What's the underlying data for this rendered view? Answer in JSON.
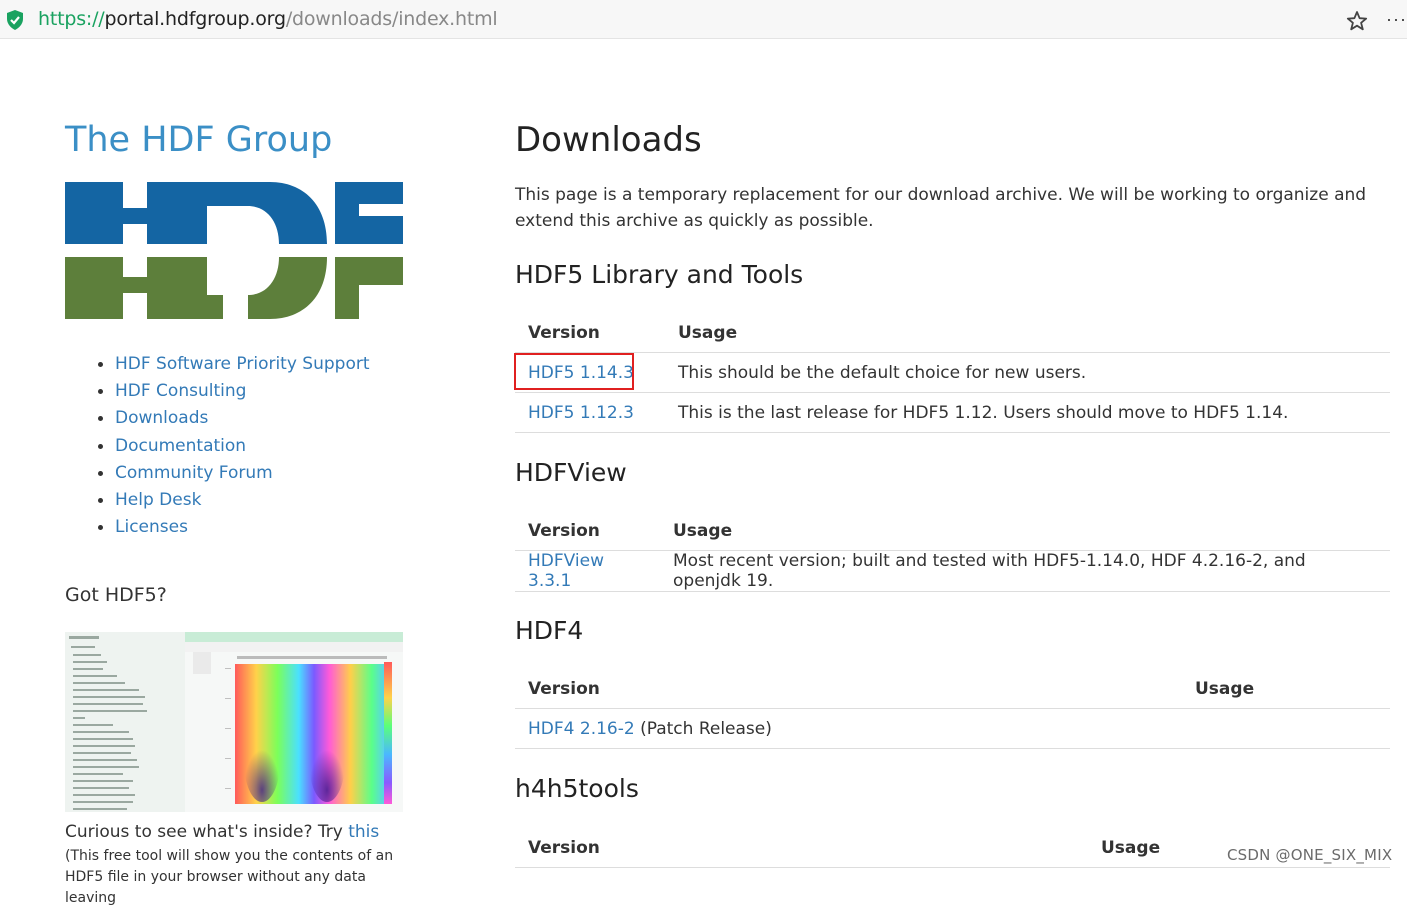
{
  "browser": {
    "url_scheme": "https://",
    "url_host": "portal.hdfgroup.org",
    "url_path": "/downloads/index.html",
    "more_label": "···"
  },
  "sidebar": {
    "brand": "The HDF Group",
    "nav": [
      {
        "label": "HDF Software Priority Support"
      },
      {
        "label": "HDF Consulting"
      },
      {
        "label": "Downloads"
      },
      {
        "label": "Documentation"
      },
      {
        "label": "Community Forum"
      },
      {
        "label": "Help Desk"
      },
      {
        "label": "Licenses"
      }
    ],
    "got_heading": "Got HDF5?",
    "curious_text": "Curious to see what's inside? Try ",
    "curious_link": "this",
    "free_tool_text": "(This free tool will show you the contents of an HDF5 file in your browser without any data leaving"
  },
  "main": {
    "title": "Downloads",
    "intro": "This page is a temporary replacement for our download archive. We will be working to organize and extend this archive as quickly as possible.",
    "sections": [
      {
        "heading": "HDF5 Library and Tools",
        "col_version": "Version",
        "col_usage": "Usage",
        "rows": [
          {
            "version": "HDF5 1.14.3",
            "usage": "This should be the default choice for new users."
          },
          {
            "version": "HDF5 1.12.3",
            "usage": "This is the last release for HDF5 1.12. Users should move to HDF5 1.14."
          }
        ]
      },
      {
        "heading": "HDFView",
        "col_version": "Version",
        "col_usage": "Usage",
        "rows": [
          {
            "version": "HDFView 3.3.1",
            "usage": "Most recent version; built and tested with HDF5-1.14.0, HDF 4.2.16-2, and openjdk 19."
          }
        ]
      },
      {
        "heading": "HDF4",
        "col_version": "Version",
        "col_usage": "Usage",
        "rows": [
          {
            "version": "HDF4 2.16-2",
            "version_note": " (Patch Release)",
            "usage": ""
          }
        ]
      },
      {
        "heading": "h4h5tools",
        "col_version": "Version",
        "col_usage": "Usage",
        "rows": []
      }
    ]
  },
  "watermark": "CSDN @ONE_SIX_MIX",
  "colors": {
    "link": "#337ab7",
    "brand": "#3b8fc6",
    "logo_blue": "#1465a3",
    "logo_green": "#5d7f3b",
    "highlight_box": "#e02020"
  }
}
